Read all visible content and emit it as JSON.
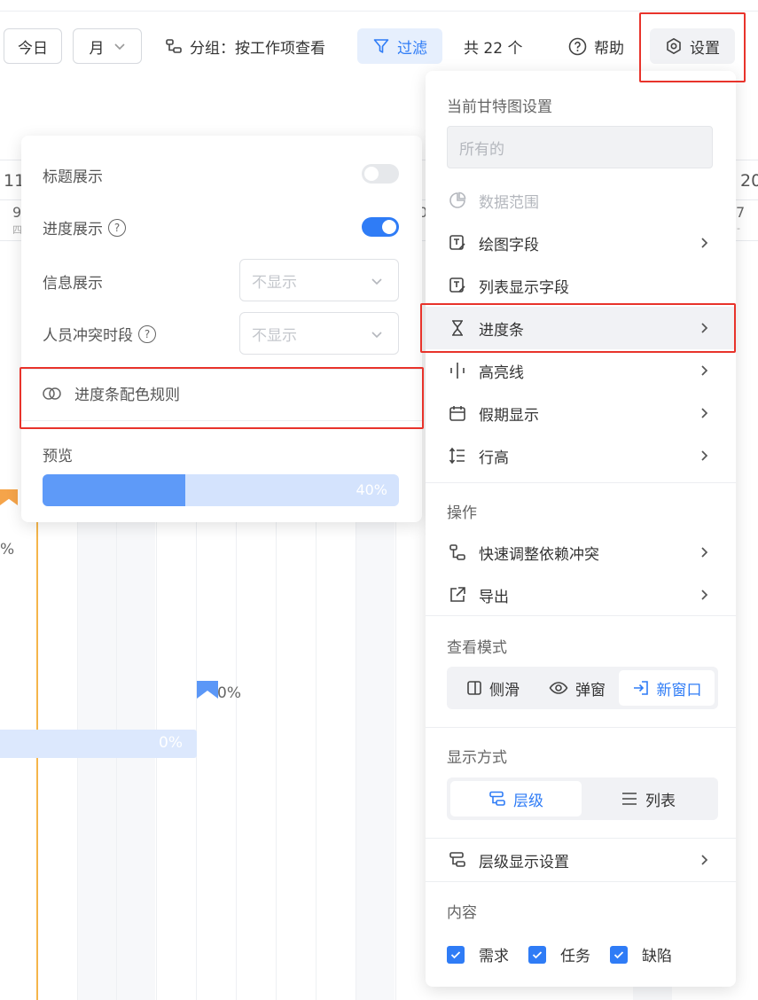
{
  "toolbar": {
    "today": "今日",
    "month": "月",
    "group": "分组：按工作项查看",
    "filter": "过滤",
    "count": "共 22 个",
    "help": "帮助",
    "settings": "设置"
  },
  "gantt": {
    "date_left_num": "11",
    "date_left_sub": "9",
    "date_left_week": "四",
    "date_mid_sub": "0",
    "date_right_num": "20",
    "date_right_sub": "7",
    "date_right_week": "-",
    "pct_left": "%",
    "pct_flag": "0%",
    "pct_bar": "0%"
  },
  "left_panel": {
    "title_display": "标题展示",
    "title_display_on": false,
    "progress_display": "进度展示",
    "progress_display_on": true,
    "info_display": "信息展示",
    "info_display_value": "不显示",
    "conflict": "人员冲突时段",
    "conflict_value": "不显示",
    "color_rule": "进度条配色规则",
    "preview_label": "预览",
    "preview_progress": 0.4,
    "preview_pct": "40%"
  },
  "right_menu": {
    "header": "当前甘特图设置",
    "scope_input": "所有的",
    "items": {
      "data_range": "数据范围",
      "draw_fields": "绘图字段",
      "list_fields": "列表显示字段",
      "progress_bar": "进度条",
      "highlight": "高亮线",
      "holidays": "假期显示",
      "row_height": "行高"
    },
    "ops_title": "操作",
    "ops": {
      "fix_conflict": "快速调整依赖冲突",
      "export": "导出"
    },
    "view_mode_title": "查看模式",
    "view_modes": {
      "side": "侧滑",
      "popup": "弹窗",
      "new_window": "新窗口"
    },
    "display_title": "显示方式",
    "display_modes": {
      "tree": "层级",
      "list": "列表"
    },
    "tree_settings": "层级显示设置",
    "content_title": "内容",
    "content": {
      "req": "需求",
      "task": "任务",
      "bug": "缺陷"
    }
  },
  "colors": {
    "accent": "#2f7cf6",
    "highlight": "#e8332b",
    "today_line": "#f5b54a"
  }
}
